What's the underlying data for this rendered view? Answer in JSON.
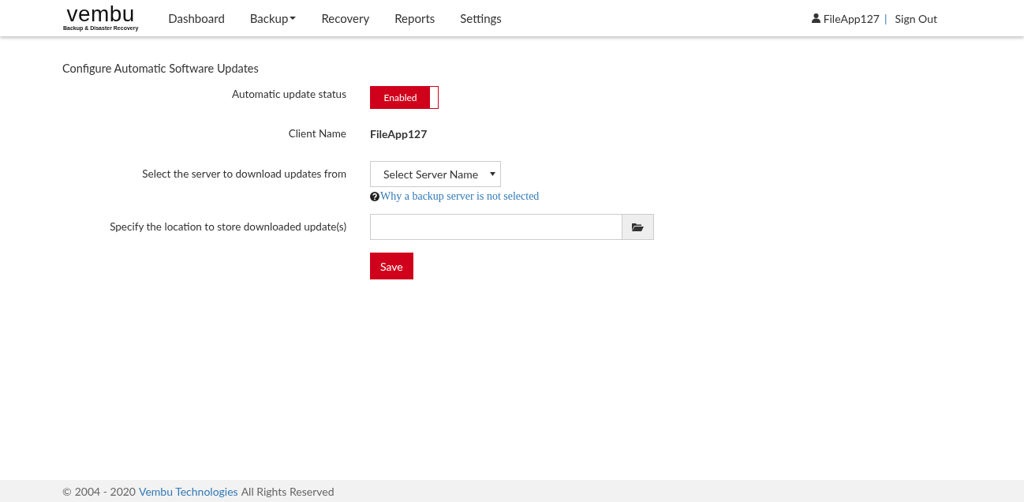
{
  "logo": {
    "name": "vembu",
    "tagline": "Backup & Disaster Recovery"
  },
  "nav": [
    {
      "label": "Dashboard",
      "dropdown": false
    },
    {
      "label": "Backup",
      "dropdown": true
    },
    {
      "label": "Recovery",
      "dropdown": false
    },
    {
      "label": "Reports",
      "dropdown": false
    },
    {
      "label": "Settings",
      "dropdown": false
    }
  ],
  "user": {
    "name": "FileApp127",
    "separator": "|",
    "sign_out": "Sign Out"
  },
  "page_title": "Configure Automatic Software Updates",
  "form": {
    "status_label": "Automatic update status",
    "toggle": {
      "label": "Enabled",
      "on": true
    },
    "client_label": "Client Name",
    "client_value": "FileApp127",
    "server_label": "Select the server to download updates from",
    "server_select": "Select Server Name",
    "help_link": "Why a backup server is not selected",
    "location_label": "Specify the location to store downloaded update(s)",
    "save": "Save"
  },
  "footer": {
    "copyright": "©",
    "years": "2004 - 2020",
    "company": "Vembu Technologies",
    "rights": "All Rights Reserved"
  }
}
